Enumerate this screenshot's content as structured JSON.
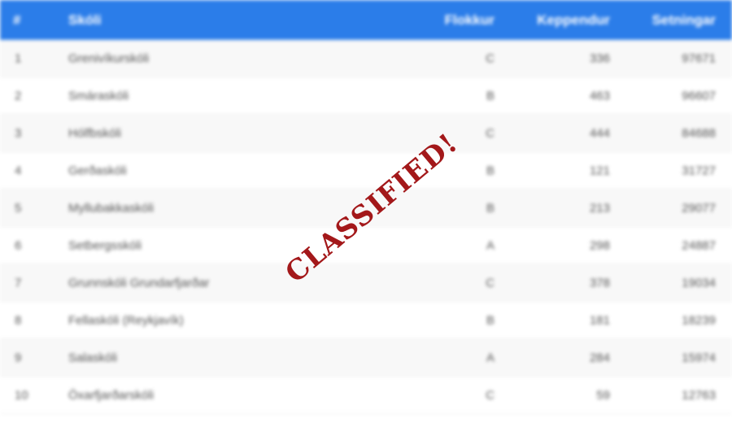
{
  "table": {
    "header": {
      "num": "#",
      "school": "Skóli",
      "category": "Flokkur",
      "competitors": "Keppendur",
      "sentences": "Setningar"
    },
    "header_color": "#2b7de9",
    "rows": [
      {
        "num": "1",
        "school": "Grenivíkurskóli",
        "category": "C",
        "competitors": "336",
        "sentences": "97671"
      },
      {
        "num": "2",
        "school": "Smáraskóli",
        "category": "B",
        "competitors": "463",
        "sentences": "96607"
      },
      {
        "num": "3",
        "school": "Hólfbskóli",
        "category": "C",
        "competitors": "444",
        "sentences": "84688"
      },
      {
        "num": "4",
        "school": "Gerðaskóli",
        "category": "B",
        "competitors": "121",
        "sentences": "31727"
      },
      {
        "num": "5",
        "school": "Myllubakkaskóli",
        "category": "B",
        "competitors": "213",
        "sentences": "29077"
      },
      {
        "num": "6",
        "school": "Setbergsskóli",
        "category": "A",
        "competitors": "298",
        "sentences": "24887"
      },
      {
        "num": "7",
        "school": "Grunnskóli Grundarfjarðar",
        "category": "C",
        "competitors": "378",
        "sentences": "19034"
      },
      {
        "num": "8",
        "school": "Fellaskóli (Reykjavík)",
        "category": "B",
        "competitors": "181",
        "sentences": "18239"
      },
      {
        "num": "9",
        "school": "Salaskóli",
        "category": "A",
        "competitors": "284",
        "sentences": "15974"
      },
      {
        "num": "10",
        "school": "Öxarfjarðarskóli",
        "category": "C",
        "competitors": "59",
        "sentences": "12763"
      }
    ]
  },
  "stamp": {
    "text": "CLASSIFIED!",
    "color": "#a3181a"
  }
}
